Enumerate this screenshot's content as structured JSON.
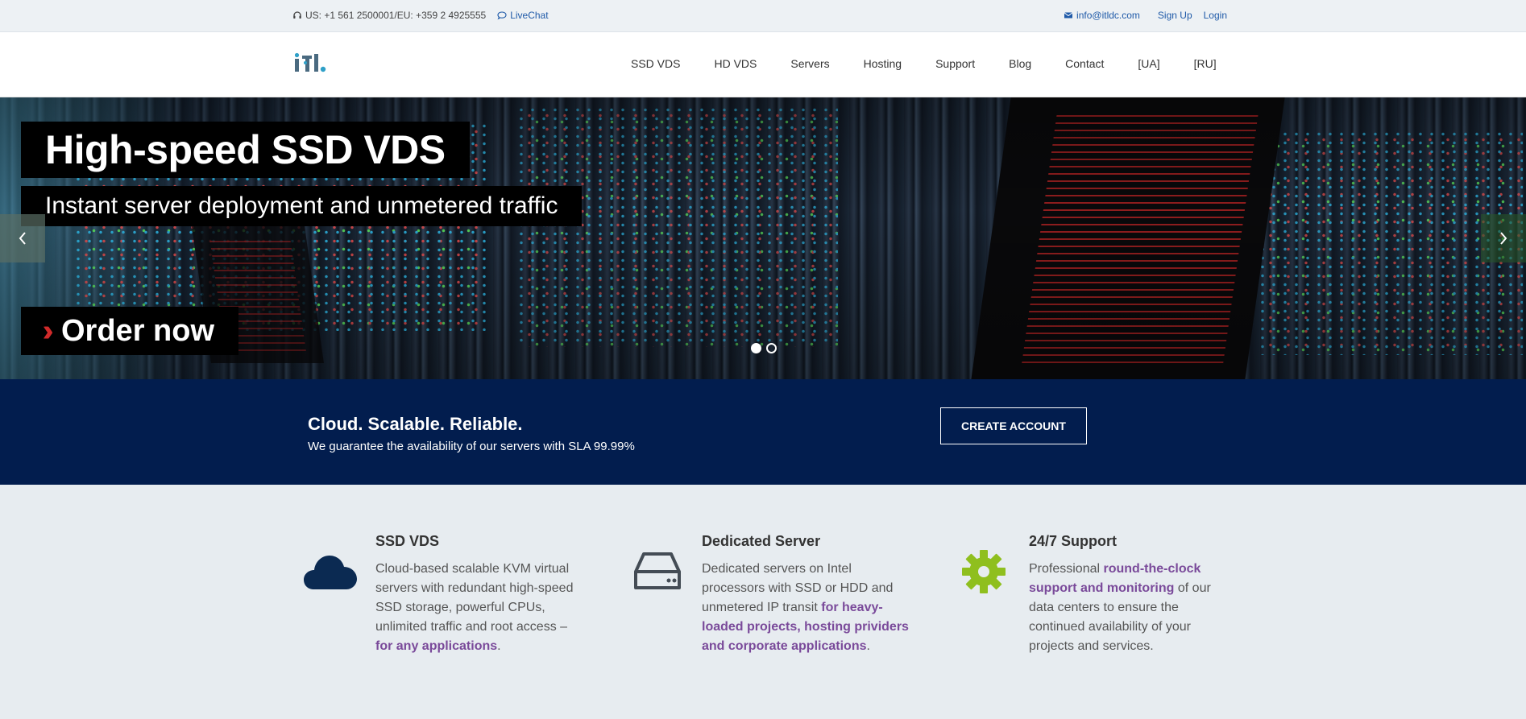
{
  "topbar": {
    "phone": "US: +1 561 2500001/EU: +359 2 4925555",
    "livechat": "LiveChat",
    "email": "info@itldc.com",
    "signup": "Sign Up",
    "login": "Login"
  },
  "logo": {
    "text": "itl."
  },
  "nav": {
    "items": [
      "SSD VDS",
      "HD VDS",
      "Servers",
      "Hosting",
      "Support",
      "Blog",
      "Contact",
      "[UA]",
      "[RU]"
    ]
  },
  "hero": {
    "title": "High-speed SSD VDS",
    "subtitle": "Instant server deployment and unmetered traffic",
    "order_label": "Order now",
    "slides_count": 2,
    "active_slide": 1
  },
  "banner": {
    "title": "Cloud. Scalable. Reliable.",
    "text": "We guarantee the availability of our servers with SLA 99.99%",
    "button": "CREATE ACCOUNT"
  },
  "features": [
    {
      "icon": "cloud-icon",
      "title": "SSD VDS",
      "text": "Cloud-based scalable KVM virtual servers with redundant high-speed SSD storage, powerful CPUs, unlimited traffic and root access –",
      "highlight": "for any applications",
      "after": "."
    },
    {
      "icon": "hard-drive-icon",
      "title": "Dedicated Server",
      "text": "Dedicated servers on Intel processors with SSD or HDD and unmetered IP transit",
      "highlight": "for heavy-loaded projects, hosting prividers and corporate applications",
      "after": "."
    },
    {
      "icon": "gear-icon",
      "title": "24/7 Support",
      "before": "Professional",
      "highlight": "round-the-clock support and monitoring",
      "text": "of our data centers to ensure the continued availability of your projects and services."
    }
  ],
  "colors": {
    "link": "#1f5aa8",
    "banner_bg": "#021d4e",
    "highlight": "#7a4a9a",
    "cloud": "#0b2a52",
    "gear": "#8fbf1e",
    "chevron_red": "#d02a2a"
  }
}
